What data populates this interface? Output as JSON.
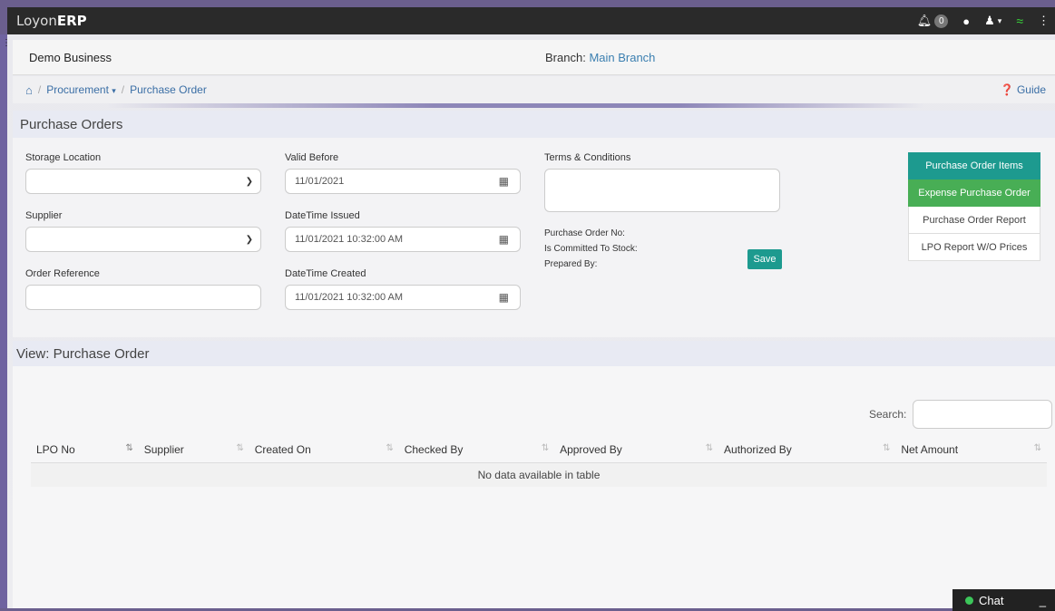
{
  "app": {
    "brand_prefix": "Loyon",
    "brand_suffix": "ERP",
    "notification_count": "0"
  },
  "business": {
    "name": "Demo Business",
    "branch_label": "Branch:",
    "branch_value": "Main Branch"
  },
  "breadcrumb": {
    "procurement": "Procurement",
    "current": "Purchase Order",
    "guide": "Guide"
  },
  "form": {
    "title": "Purchase Orders",
    "storage_location_label": "Storage Location",
    "supplier_label": "Supplier",
    "order_reference_label": "Order Reference",
    "valid_before_label": "Valid Before",
    "valid_before_value": "11/01/2021",
    "datetime_issued_label": "DateTime Issued",
    "datetime_issued_value": "11/01/2021 10:32:00 AM",
    "datetime_created_label": "DateTime Created",
    "datetime_created_value": "11/01/2021 10:32:00 AM",
    "terms_label": "Terms & Conditions",
    "po_no_label": "Purchase Order No:",
    "committed_label": "Is Committed To Stock:",
    "prepared_label": "Prepared By:",
    "save_label": "Save"
  },
  "side_buttons": [
    "Purchase Order Items",
    "Expense Purchase Order",
    "Purchase Order Report",
    "LPO Report W/O Prices"
  ],
  "view": {
    "title": "View: Purchase Order",
    "search_label": "Search:",
    "columns": [
      "LPO No",
      "Supplier",
      "Created On",
      "Checked By",
      "Approved By",
      "Authorized By",
      "Net Amount"
    ],
    "empty_message": "No data available in table"
  },
  "chat": {
    "label": "Chat"
  },
  "colors": {
    "teal": "#1d9a8f",
    "green": "#48ae55",
    "link": "#3a6ea5"
  }
}
